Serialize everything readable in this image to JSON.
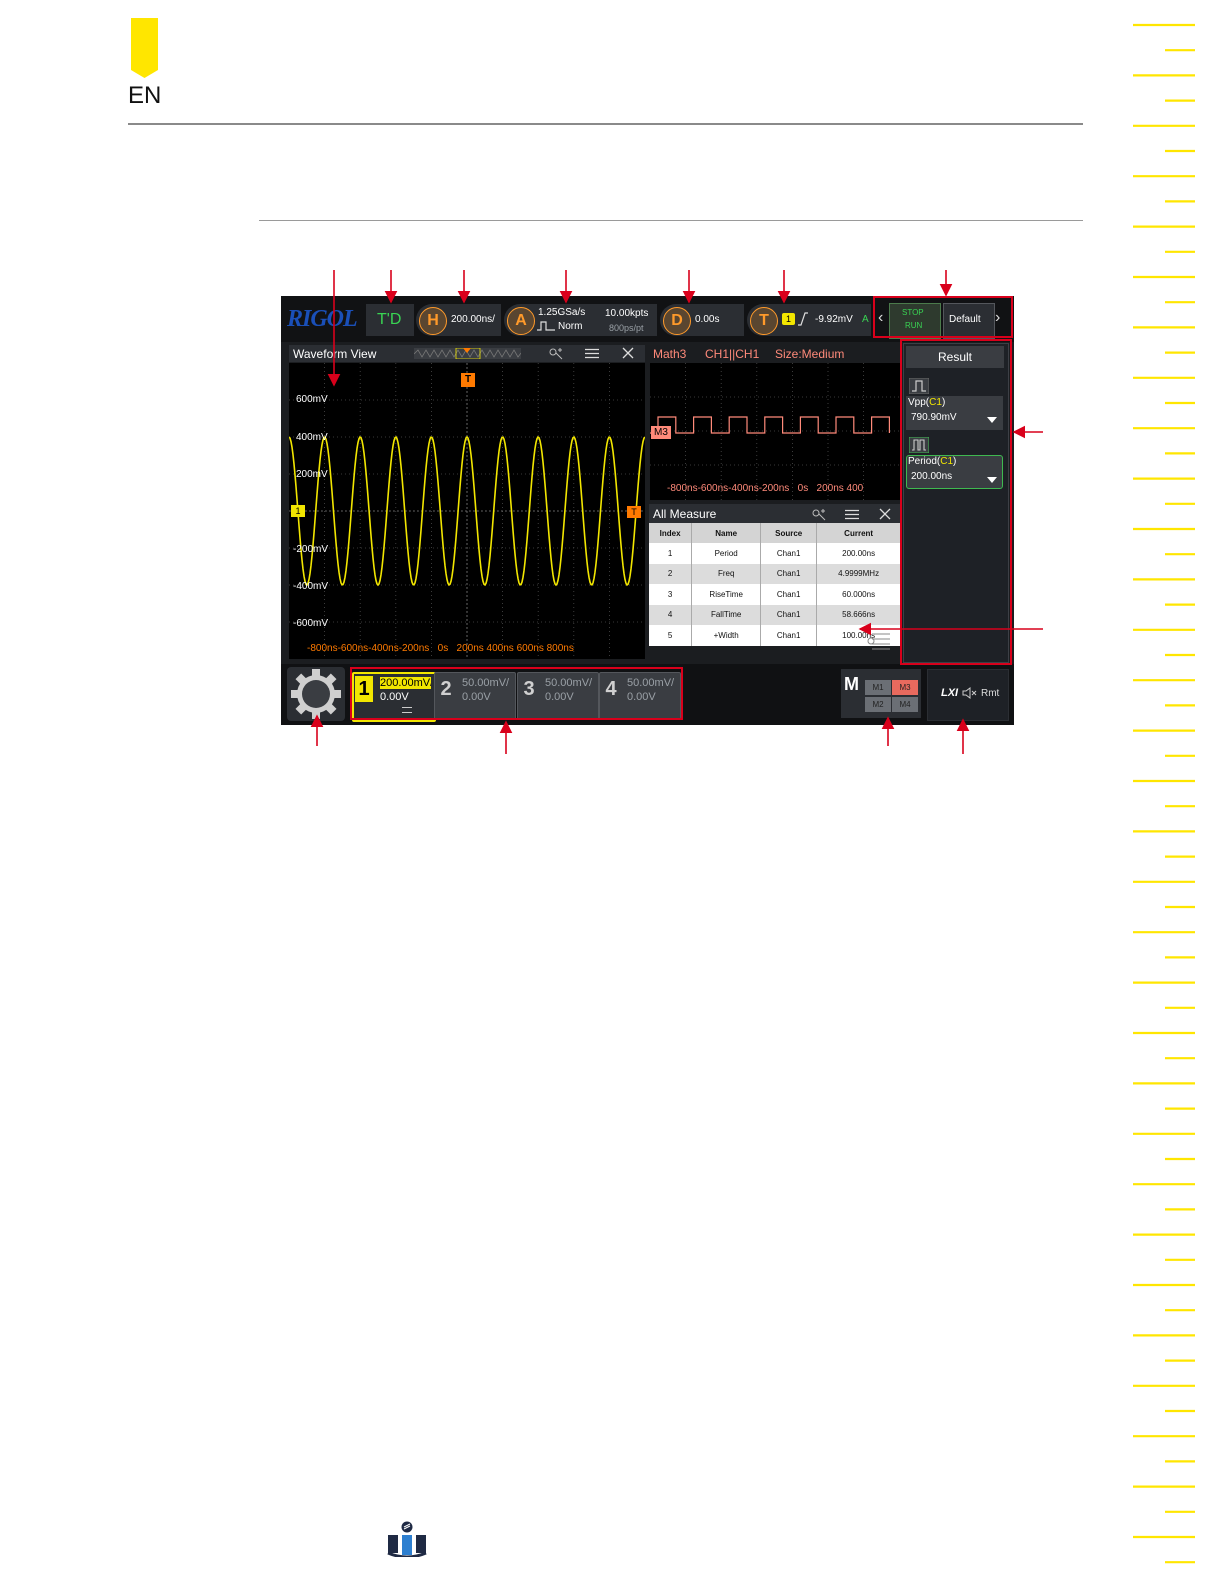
{
  "header": {
    "language": "EN"
  },
  "scope": {
    "logo": "RIGOL",
    "trigger_status": "T'D",
    "horizontal": {
      "label": "H",
      "timebase": "200.00ns/"
    },
    "acquire": {
      "label": "A",
      "sample_rate": "1.25GSa/s",
      "memory_depth": "10.00kpts",
      "mode": "Norm",
      "resolution": "800ps/pt"
    },
    "delay": {
      "label": "D",
      "value": "0.00s"
    },
    "trigger": {
      "label": "T",
      "source": "1",
      "level": "-9.92mV",
      "mode": "A"
    },
    "run_stop": {
      "stop": "STOP",
      "run": "RUN"
    },
    "default_label": "Default",
    "waveform_view": {
      "title": "Waveform View",
      "trigger_marker": "T",
      "channel_marker": "1",
      "y_labels": [
        "600mV",
        "400mV",
        "200mV",
        "-200mV",
        "-400mV",
        "-600mV"
      ],
      "x_labels": "-800ns-600ns-400ns-200ns   0s   200ns 400ns 600ns 800ns"
    },
    "math_view": {
      "title_source": "Math3",
      "title_expr": "CH1||CH1",
      "title_size": "Size:Medium",
      "marker": "M3",
      "x_labels": "-800ns-600ns-400ns-200ns   0s   200ns 400"
    },
    "all_measure": {
      "title": "All Measure",
      "headers": [
        "Index",
        "Name",
        "Source",
        "Current"
      ],
      "rows": [
        [
          "1",
          "Period",
          "Chan1",
          "200.00ns"
        ],
        [
          "2",
          "Freq",
          "Chan1",
          "4.9999MHz"
        ],
        [
          "3",
          "RiseTime",
          "Chan1",
          "60.000ns"
        ],
        [
          "4",
          "FallTime",
          "Chan1",
          "58.666ns"
        ],
        [
          "5",
          "+Width",
          "Chan1",
          "100.00ns"
        ]
      ]
    },
    "result": {
      "title": "Result",
      "items": [
        {
          "name": "Vpp",
          "source": "C1",
          "value": "790.90mV"
        },
        {
          "name": "Period",
          "source": "C1",
          "value": "200.00ns"
        }
      ]
    },
    "channels": [
      {
        "num": "1",
        "scale": "200.00mV/",
        "offset": "0.00V",
        "color": "#f2e600"
      },
      {
        "num": "2",
        "scale": "50.00mV/",
        "offset": "0.00V",
        "color": "#9aa0a6"
      },
      {
        "num": "3",
        "scale": "50.00mV/",
        "offset": "0.00V",
        "color": "#9aa0a6"
      },
      {
        "num": "4",
        "scale": "50.00mV/",
        "offset": "0.00V",
        "color": "#9aa0a6"
      }
    ],
    "math": {
      "label": "M",
      "buttons": [
        "M1",
        "M3",
        "M2",
        "M4"
      ]
    },
    "remote": {
      "lxi": "LXI",
      "rmt": "Rmt"
    }
  },
  "colors": {
    "ch1": "#f2e600",
    "trigger": "#ff7a00",
    "math": "#ff8a7a",
    "callout": "#d9001b",
    "accent": "#ffe600"
  }
}
